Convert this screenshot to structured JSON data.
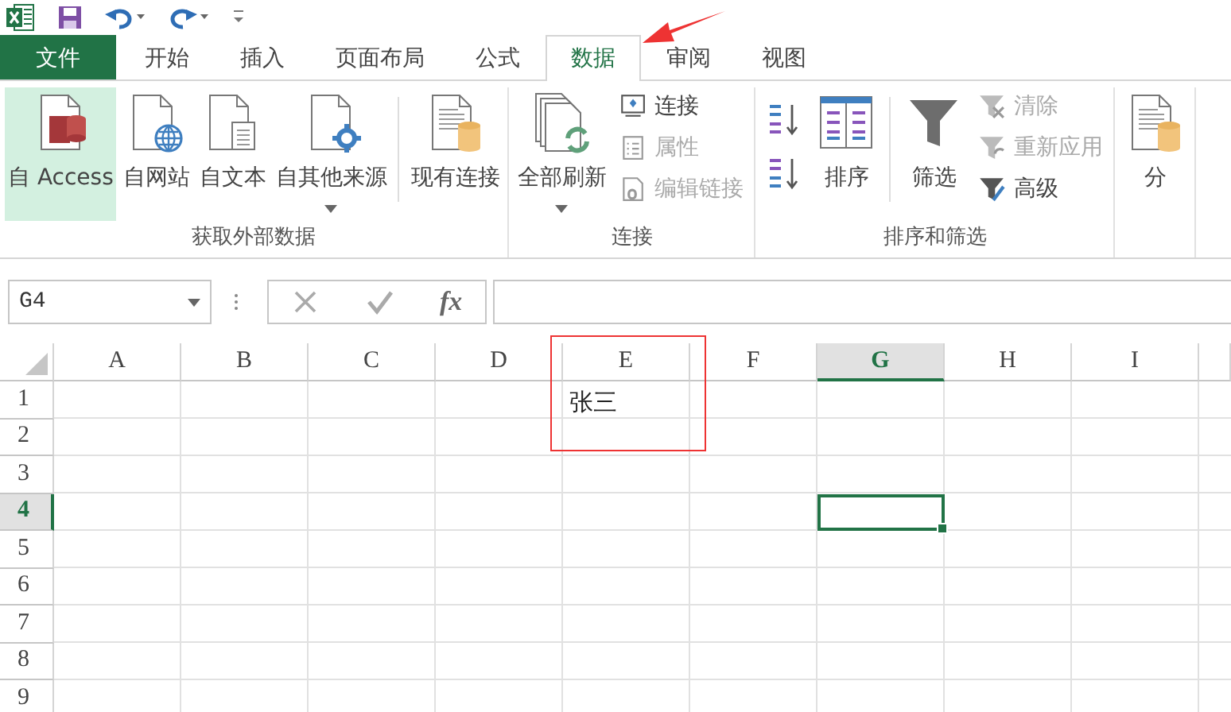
{
  "tabs": [
    {
      "label": "文件",
      "kind": "file",
      "selected": false
    },
    {
      "label": "开始",
      "kind": "tab",
      "selected": false
    },
    {
      "label": "插入",
      "kind": "tab",
      "selected": false
    },
    {
      "label": "页面布局",
      "kind": "tab",
      "selected": false
    },
    {
      "label": "公式",
      "kind": "tab",
      "selected": false
    },
    {
      "label": "数据",
      "kind": "tab",
      "selected": true
    },
    {
      "label": "审阅",
      "kind": "tab",
      "selected": false
    },
    {
      "label": "视图",
      "kind": "tab",
      "selected": false
    }
  ],
  "ribbon_groups": [
    {
      "label": "获取外部数据",
      "items": [
        {
          "kind": "large",
          "label": "自 Access",
          "selected": true,
          "dropdown": false
        },
        {
          "kind": "large",
          "label": "自网站",
          "selected": false,
          "dropdown": false
        },
        {
          "kind": "large",
          "label": "自文本",
          "selected": false,
          "dropdown": false
        },
        {
          "kind": "large",
          "label": "自其他来源",
          "selected": false,
          "dropdown": true
        },
        {
          "kind": "separator"
        },
        {
          "kind": "large",
          "label": "现有连接",
          "selected": false,
          "dropdown": false
        }
      ]
    },
    {
      "label": "连接",
      "items": [
        {
          "kind": "large",
          "label": "全部刷新",
          "selected": false,
          "dropdown": true
        },
        {
          "kind": "stack",
          "items": [
            {
              "label": "连接",
              "disabled": false
            },
            {
              "label": "属性",
              "disabled": true
            },
            {
              "label": "编辑链接",
              "disabled": true
            }
          ]
        }
      ]
    },
    {
      "label": "排序和筛选",
      "items": [
        {
          "kind": "sort-buttons"
        },
        {
          "kind": "large",
          "label": "排序",
          "selected": false,
          "dropdown": false
        },
        {
          "kind": "separator"
        },
        {
          "kind": "large",
          "label": "筛选",
          "selected": false,
          "dropdown": false
        },
        {
          "kind": "stack",
          "items": [
            {
              "label": "清除",
              "disabled": true
            },
            {
              "label": "重新应用",
              "disabled": true
            },
            {
              "label": "高级",
              "disabled": false
            }
          ]
        }
      ]
    },
    {
      "items": [
        {
          "kind": "large",
          "label": "分",
          "selected": false,
          "dropdown": false
        }
      ]
    }
  ],
  "formula_bar": {
    "name_box": "G4",
    "function_label": "fx"
  },
  "sheet": {
    "columns": [
      {
        "label": "A",
        "selected": false
      },
      {
        "label": "B",
        "selected": false
      },
      {
        "label": "C",
        "selected": false
      },
      {
        "label": "D",
        "selected": false
      },
      {
        "label": "E",
        "selected": false
      },
      {
        "label": "F",
        "selected": false
      },
      {
        "label": "G",
        "selected": true
      },
      {
        "label": "H",
        "selected": false
      },
      {
        "label": "I",
        "selected": false
      }
    ],
    "rows": [
      {
        "label": "1",
        "selected": false,
        "cells": [
          null,
          null,
          null,
          null,
          "张三"
        ]
      },
      {
        "label": "2",
        "selected": false
      },
      {
        "label": "3",
        "selected": false
      },
      {
        "label": "4",
        "selected": true
      },
      {
        "label": "5",
        "selected": false
      },
      {
        "label": "6",
        "selected": false
      },
      {
        "label": "7",
        "selected": false
      },
      {
        "label": "8",
        "selected": false
      },
      {
        "label": "9",
        "selected": false
      }
    ]
  }
}
